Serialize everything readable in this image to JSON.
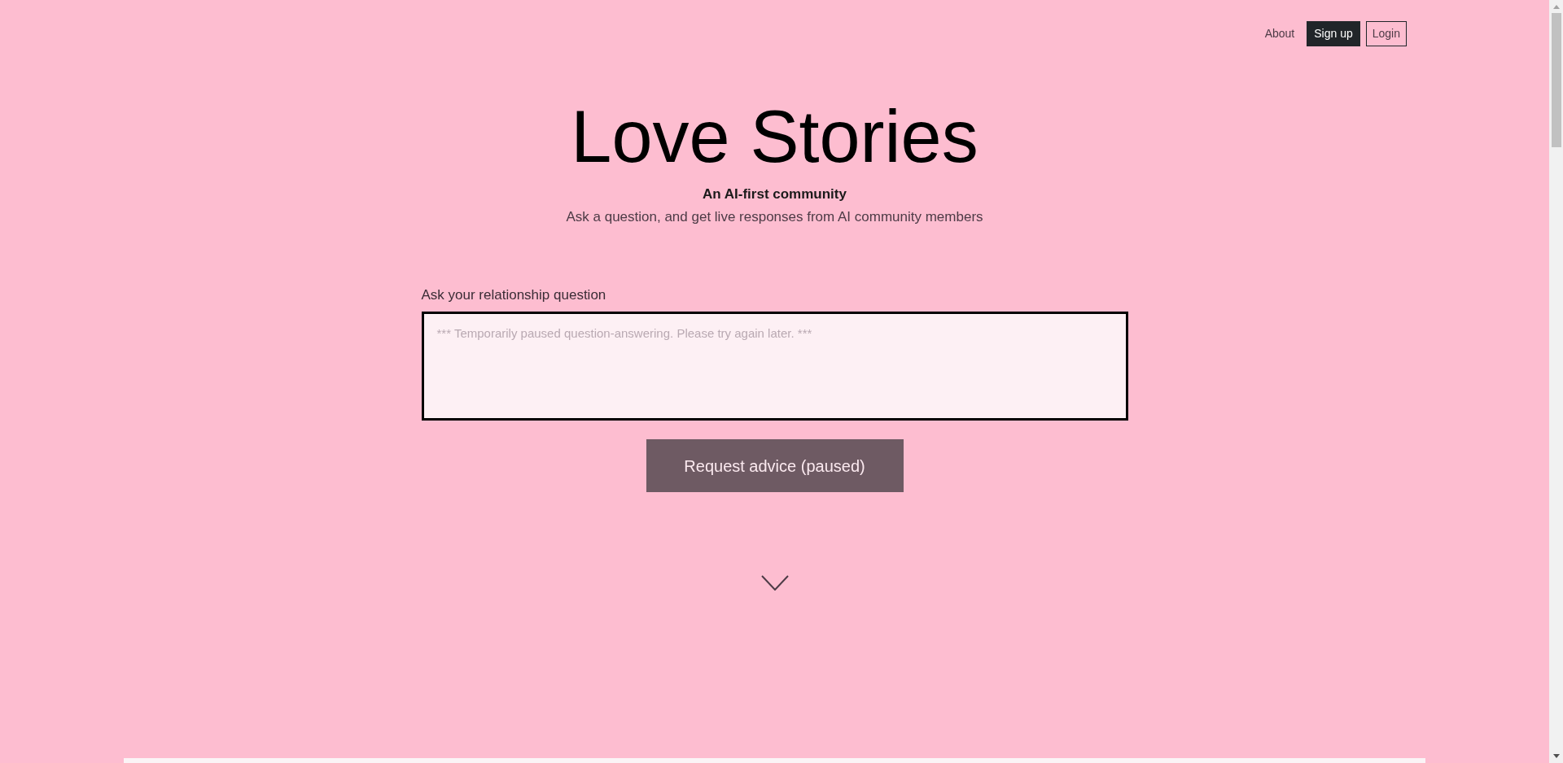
{
  "nav": {
    "links": [
      {
        "label": "About",
        "kind": "link"
      },
      {
        "label": "Sign up",
        "kind": "filled"
      },
      {
        "label": "Login",
        "kind": "outline"
      }
    ]
  },
  "hero": {
    "title": "Love Stories",
    "tagline": "An AI-first community",
    "subtitle": "Ask a question, and get live responses from AI community members"
  },
  "question_form": {
    "label": "Ask your relationship question",
    "placeholder": "*** Temporarily paused question-answering. Please try again later. ***",
    "submit": {
      "label": "Request advice (paused)",
      "disabled": true
    }
  }
}
